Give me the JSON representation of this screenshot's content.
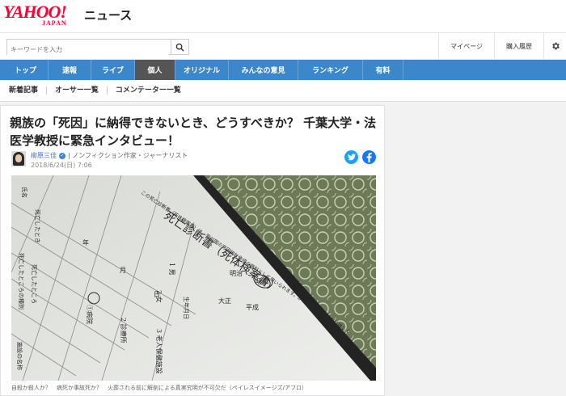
{
  "header": {
    "logo_main": "YAHOO!",
    "logo_sub": "JAPAN",
    "service": "ニュース"
  },
  "search": {
    "placeholder": "キーワードを入力",
    "button_icon": "search-icon"
  },
  "toplinks": [
    "マイページ",
    "購入履歴"
  ],
  "settings_icon": "gear-icon",
  "nav": {
    "items": [
      "トップ",
      "速報",
      "ライブ",
      "個人",
      "オリジナル",
      "みんなの意見",
      "ランキング",
      "有料"
    ],
    "active": "個人"
  },
  "subnav": [
    "新着記事",
    "オーサー一覧",
    "コメンテーター一覧"
  ],
  "article": {
    "title": "親族の「死因」に納得できないとき、どうすべきか？ 千葉大学・法医学教授に緊急インタビュー！",
    "author": "柳原三佳",
    "author_role": "| ノンフィクション作家・ジャーナリスト",
    "date": "2018/6/24(日) 7:06",
    "photo": {
      "form_title": "死亡診断書（死体検案書）",
      "form_note": "この死亡診断書（死体検案書）は、我が国の死因統計作成の資料として用いられます。かい書で、できるだけ詳しく",
      "row_labels": [
        "氏名",
        "死亡したとき",
        "死亡したところの種別",
        "死亡したところ",
        "施設の名称"
      ],
      "sex_options": [
        "1 男",
        "2 女"
      ],
      "birth_label": "生年月日",
      "era_labels": [
        "明治",
        "昭和",
        "大正",
        "平成"
      ],
      "date_labels": [
        "年",
        "月",
        "日"
      ],
      "place_options": [
        "①病院",
        "2 診療所",
        "3 老人保健施設"
      ]
    },
    "caption": "自殺か殺人か？　病死か事故死か？　火葬される前に解剖による真実究明が不可欠だ（ペイレスイメージズ/アフロ）"
  },
  "colors": {
    "brand_red": "#ff0033",
    "nav_blue": "#3c87c9",
    "nav_active": "#555555",
    "twitter": "#1da1f2",
    "facebook": "#1877f2"
  }
}
